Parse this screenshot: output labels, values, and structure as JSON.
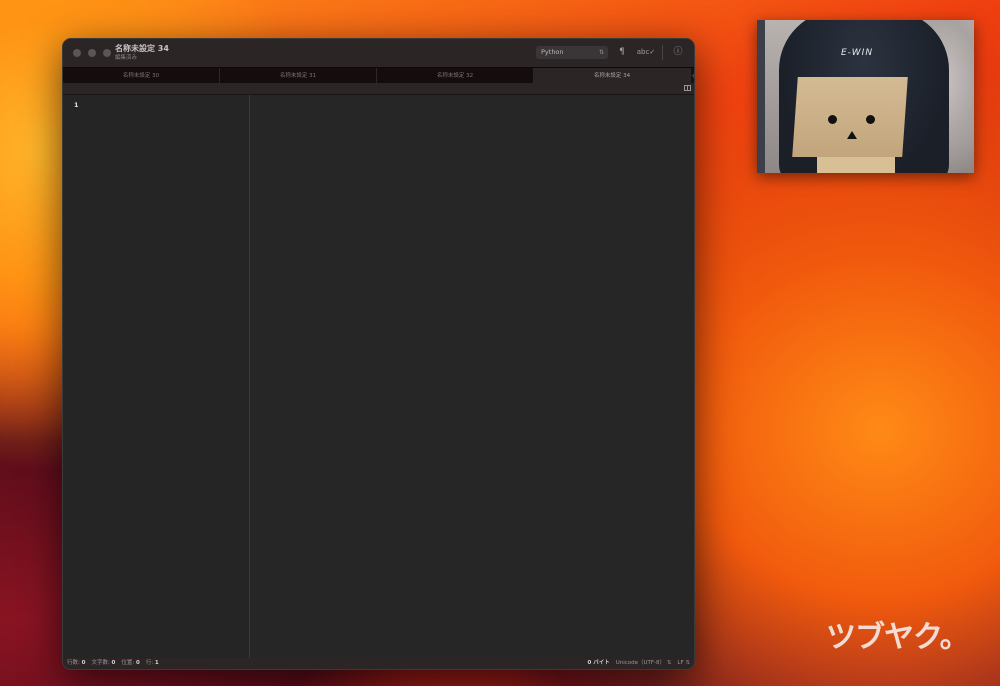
{
  "window": {
    "title": "名称未設定 34",
    "subtitle": "編集済み",
    "syntax_select": "Python",
    "icons": {
      "invisibles": "¶",
      "spellcheck": "abc✓",
      "info": "ⓘ"
    }
  },
  "tabs": [
    {
      "label": "名称未設定 30",
      "active": false
    },
    {
      "label": "名称未設定 31",
      "active": false
    },
    {
      "label": "名称未設定 32",
      "active": false
    },
    {
      "label": "名称未設定 34",
      "active": true
    }
  ],
  "editor": {
    "line_numbers": [
      "1"
    ],
    "content": ""
  },
  "statusbar": {
    "lines_label": "行数:",
    "lines_value": "0",
    "chars_label": "文字数:",
    "chars_value": "0",
    "pos_label": "位置:",
    "pos_value": "0",
    "row_label": "行:",
    "row_value": "1",
    "bytes": "0 バイト",
    "encoding": "Unicode（UTF-8）",
    "line_ending": "LF"
  },
  "overlay": {
    "camera_label": "E-WIN",
    "watermark": "ツブヤク。"
  }
}
